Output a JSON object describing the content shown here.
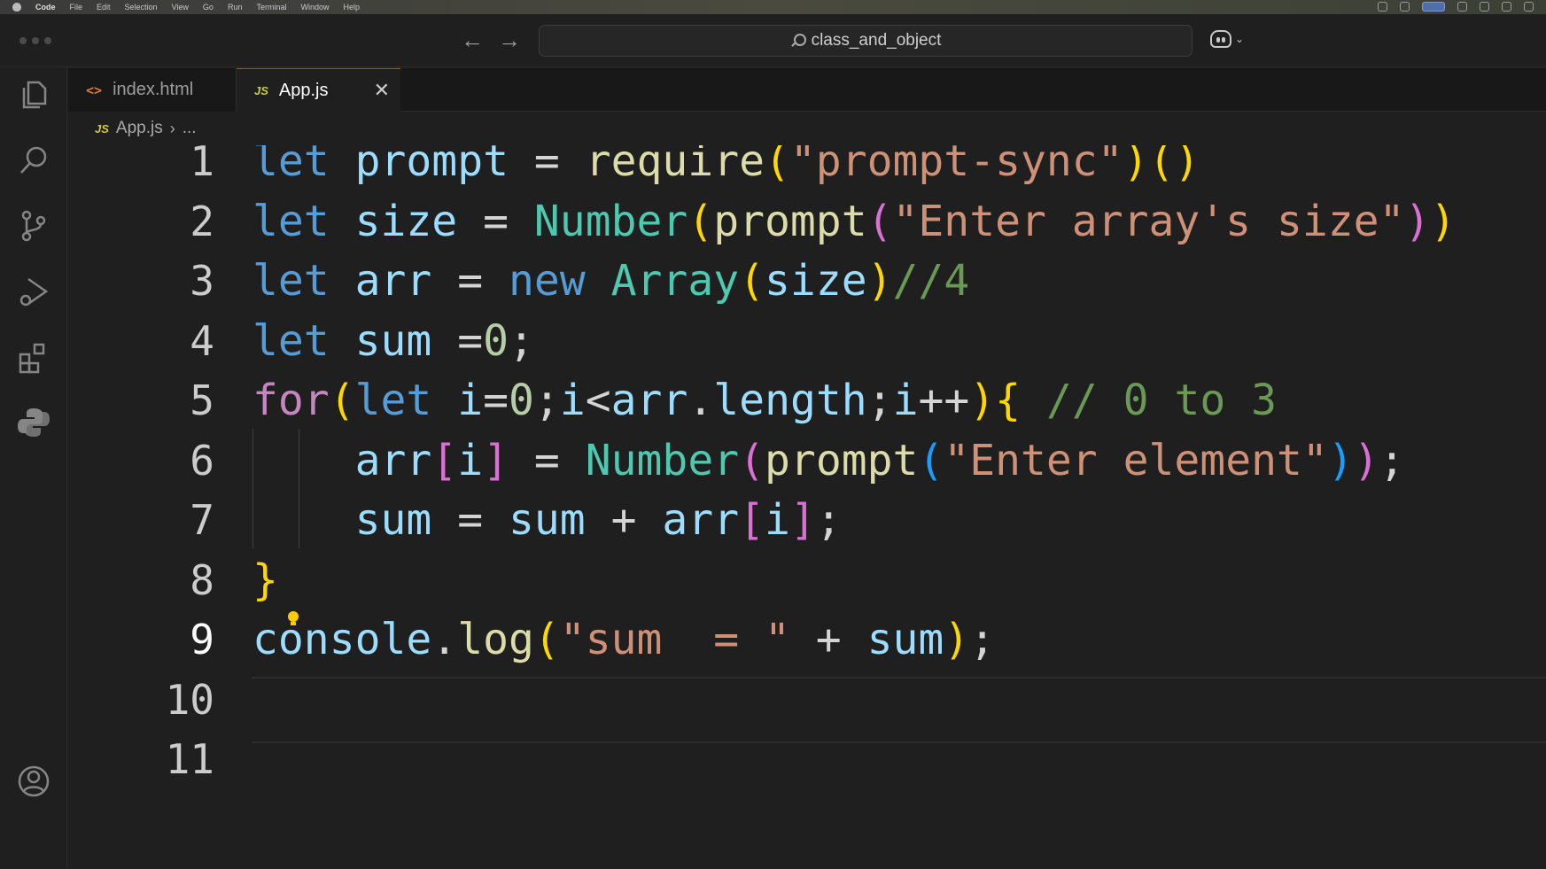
{
  "menubar": {
    "items": [
      "Code",
      "File",
      "Edit",
      "Selection",
      "View",
      "Go",
      "Run",
      "Terminal",
      "Window",
      "Help"
    ]
  },
  "titlebar": {
    "search_text": "class_and_object"
  },
  "tabs": [
    {
      "label": "index.html",
      "icon": "html-icon",
      "active": false
    },
    {
      "label": "App.js",
      "icon": "js-icon",
      "active": true,
      "close": "✕"
    }
  ],
  "breadcrumb": {
    "file": "App.js",
    "rest": "..."
  },
  "editor": {
    "current_line": 9,
    "line_numbers": [
      "1",
      "2",
      "3",
      "4",
      "5",
      "6",
      "7",
      "8",
      "9",
      "10",
      "11"
    ],
    "lines": [
      [
        [
          "kw",
          "let"
        ],
        [
          "op",
          " "
        ],
        [
          "var",
          "prompt"
        ],
        [
          "op",
          " = "
        ],
        [
          "fn",
          "require"
        ],
        [
          "p1",
          "("
        ],
        [
          "str",
          "\"prompt-sync\""
        ],
        [
          "p1",
          ")"
        ],
        [
          "p1",
          "("
        ],
        [
          "p1",
          ")"
        ]
      ],
      [
        [
          "kw",
          "let"
        ],
        [
          "op",
          " "
        ],
        [
          "var",
          "size"
        ],
        [
          "op",
          " = "
        ],
        [
          "cls",
          "Number"
        ],
        [
          "p1",
          "("
        ],
        [
          "fn",
          "prompt"
        ],
        [
          "p2",
          "("
        ],
        [
          "str",
          "\"Enter array's size\""
        ],
        [
          "p2",
          ")"
        ],
        [
          "p1",
          ")"
        ]
      ],
      [
        [
          "kw",
          "let"
        ],
        [
          "op",
          " "
        ],
        [
          "var",
          "arr"
        ],
        [
          "op",
          " = "
        ],
        [
          "kw",
          "new"
        ],
        [
          "op",
          " "
        ],
        [
          "cls",
          "Array"
        ],
        [
          "p1",
          "("
        ],
        [
          "var",
          "size"
        ],
        [
          "p1",
          ")"
        ],
        [
          "com",
          "//4"
        ]
      ],
      [
        [
          "kw",
          "let"
        ],
        [
          "op",
          " "
        ],
        [
          "var",
          "sum"
        ],
        [
          "op",
          " ="
        ],
        [
          "num",
          "0"
        ],
        [
          "op",
          ";"
        ]
      ],
      [
        [
          "ctl",
          "for"
        ],
        [
          "p1",
          "("
        ],
        [
          "kw",
          "let"
        ],
        [
          "op",
          " "
        ],
        [
          "var",
          "i"
        ],
        [
          "op",
          "="
        ],
        [
          "num",
          "0"
        ],
        [
          "op",
          ";"
        ],
        [
          "var",
          "i"
        ],
        [
          "op",
          "<"
        ],
        [
          "var",
          "arr"
        ],
        [
          "op",
          "."
        ],
        [
          "var",
          "length"
        ],
        [
          "op",
          ";"
        ],
        [
          "var",
          "i"
        ],
        [
          "op",
          "++"
        ],
        [
          "p1",
          ")"
        ],
        [
          "p1",
          "{"
        ],
        [
          "op",
          " "
        ],
        [
          "com",
          "// 0 to 3"
        ]
      ],
      [
        [
          "op",
          "    "
        ],
        [
          "var",
          "arr"
        ],
        [
          "p2",
          "["
        ],
        [
          "var",
          "i"
        ],
        [
          "p2",
          "]"
        ],
        [
          "op",
          " = "
        ],
        [
          "cls",
          "Number"
        ],
        [
          "p2",
          "("
        ],
        [
          "fn",
          "prompt"
        ],
        [
          "p3",
          "("
        ],
        [
          "str",
          "\"Enter element\""
        ],
        [
          "p3",
          ")"
        ],
        [
          "p2",
          ")"
        ],
        [
          "op",
          ";"
        ]
      ],
      [
        [
          "op",
          "    "
        ],
        [
          "var",
          "sum"
        ],
        [
          "op",
          " = "
        ],
        [
          "var",
          "sum"
        ],
        [
          "op",
          " + "
        ],
        [
          "var",
          "arr"
        ],
        [
          "p2",
          "["
        ],
        [
          "var",
          "i"
        ],
        [
          "p2",
          "]"
        ],
        [
          "op",
          ";"
        ]
      ],
      [
        [
          "p1",
          "}"
        ]
      ],
      [
        [
          "var",
          "console"
        ],
        [
          "op",
          "."
        ],
        [
          "fn",
          "log"
        ],
        [
          "p1",
          "("
        ],
        [
          "str",
          "\"sum  = \""
        ],
        [
          "op",
          " + "
        ],
        [
          "var",
          "sum"
        ],
        [
          "p1",
          ")"
        ],
        [
          "op",
          ";"
        ]
      ],
      [],
      []
    ]
  },
  "activitybar": [
    "explorer-icon",
    "search-icon",
    "source-control-icon",
    "run-debug-icon",
    "extensions-icon",
    "python-icon",
    "accounts-icon"
  ]
}
